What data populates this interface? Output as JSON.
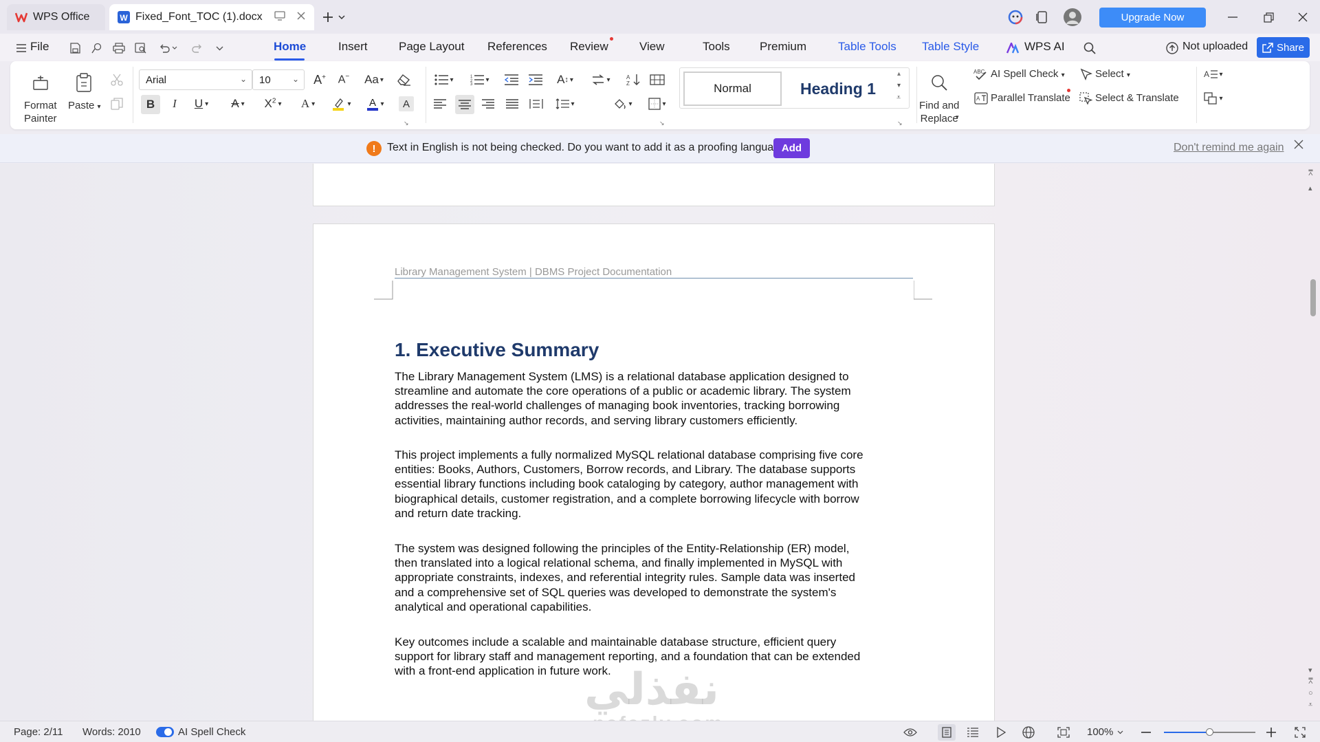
{
  "tabs": {
    "app_tab": "WPS Office",
    "doc_tab": "Fixed_Font_TOC (1).docx"
  },
  "titlebar": {
    "upgrade": "Upgrade Now"
  },
  "menubar": {
    "file": "File",
    "items": [
      "Home",
      "Insert",
      "Page Layout",
      "References",
      "Review",
      "View",
      "Tools",
      "Premium",
      "Table Tools",
      "Table Style",
      "WPS AI"
    ],
    "not_uploaded": "Not uploaded",
    "share": "Share"
  },
  "ribbon": {
    "format_painter": "Format\nPainter",
    "paste": "Paste",
    "font_name": "Arial",
    "font_size": "10",
    "style_normal": "Normal",
    "style_heading1": "Heading 1",
    "find_replace": "Find and\nReplace",
    "ai_spell_check": "AI Spell Check",
    "parallel_translate": "Parallel Translate",
    "select": "Select",
    "select_translate": "Select & Translate"
  },
  "notification": {
    "message": "Text in English is not being checked. Do you want to add it as a proofing language?",
    "add": "Add",
    "dismiss": "Don't remind me again"
  },
  "document": {
    "header": "Library Management System  |  DBMS Project Documentation",
    "heading": "1. Executive Summary",
    "paragraphs": [
      "The Library Management System (LMS) is a relational database application designed to\nstreamline and automate the core operations of a public or academic library. The system\naddresses the real-world challenges of managing book inventories, tracking borrowing\nactivities, maintaining author records, and serving library customers efficiently.",
      "This project implements a fully normalized MySQL relational database comprising five core\nentities: Books, Authors, Customers, Borrow records, and Library. The database supports\nessential library functions including book cataloging by category, author management with\nbiographical details, customer registration, and a complete borrowing lifecycle with borrow\nand return date tracking.",
      "The system was designed following the principles of the Entity-Relationship (ER) model,\nthen translated into a logical relational schema, and finally implemented in MySQL with\nappropriate constraints, indexes, and referential integrity rules. Sample data was inserted\nand a comprehensive set of SQL queries was developed to demonstrate the system's\nanalytical and operational capabilities.",
      "Key outcomes include a scalable and maintainable database structure, efficient query\nsupport for library staff and management reporting, and a foundation that can be extended\nwith a front-end application in future work."
    ]
  },
  "watermark": {
    "arabic": "نفذلي",
    "latin": "nafezly.com"
  },
  "statusbar": {
    "page": "Page: 2/11",
    "words": "Words: 2010",
    "ai_spell": "AI Spell Check",
    "zoom": "100%",
    "zoom_level": 0.5
  },
  "colors": {
    "accent": "#2a6be8",
    "upgrade": "#3d8cf8",
    "add_button": "#6e3bde",
    "heading": "#1f3a6b",
    "warning": "#f07a1a"
  }
}
